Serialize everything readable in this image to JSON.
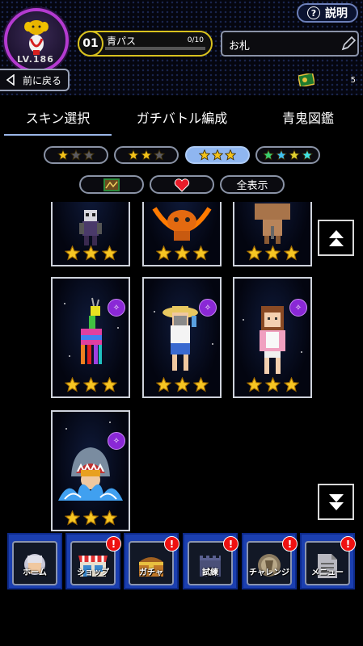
{
  "header": {
    "help_label": "説明",
    "help_icon": "question-circle-icon",
    "level_text": "LV.186",
    "pass": {
      "number": "01",
      "label": "青パス",
      "count": "0/10",
      "progress": 0.0
    },
    "name_value": "お札",
    "back_label": "前に戻る",
    "ticket_count": "5"
  },
  "tabs": [
    {
      "label": "スキン選択",
      "active": true
    },
    {
      "label": "ガチバトル編成",
      "active": false
    },
    {
      "label": "青鬼図鑑",
      "active": false
    }
  ],
  "star_filters": [
    {
      "filled": 1,
      "total": 3,
      "active": false
    },
    {
      "filled": 2,
      "total": 3,
      "active": false
    },
    {
      "filled": 3,
      "total": 3,
      "active": true
    },
    {
      "filled": 4,
      "total": 4,
      "active": false,
      "rainbow": true
    }
  ],
  "type_filters": [
    {
      "icon": "map-icon"
    },
    {
      "icon": "heart-icon"
    },
    {
      "label": "全表示"
    }
  ],
  "cards": [
    {
      "name": "character-skin-card",
      "stars": 3,
      "new": false
    },
    {
      "name": "character-skin-card",
      "stars": 3,
      "new": false
    },
    {
      "name": "character-skin-card",
      "stars": 3,
      "new": false
    },
    {
      "name": "rainbow-deer-skin-card",
      "stars": 3,
      "new": true
    },
    {
      "name": "summer-boy-skin-card",
      "stars": 3,
      "new": true
    },
    {
      "name": "pink-jacket-girl-skin-card",
      "stars": 3,
      "new": true
    },
    {
      "name": "shark-skin-card",
      "stars": 3,
      "new": true
    }
  ],
  "nav": [
    {
      "label": "ホーム",
      "icon": "home-avatar-icon",
      "alert": false
    },
    {
      "label": "ショップ",
      "icon": "shop-icon",
      "alert": true
    },
    {
      "label": "ガチャ",
      "icon": "treasure-chest-icon",
      "alert": true
    },
    {
      "label": "試練",
      "icon": "castle-icon",
      "alert": true
    },
    {
      "label": "チャレンジ",
      "icon": "challenge-coin-icon",
      "alert": true
    },
    {
      "label": "メニュー",
      "icon": "menu-document-icon",
      "alert": true
    }
  ],
  "alert_mark": "!",
  "new_badge": "✧"
}
